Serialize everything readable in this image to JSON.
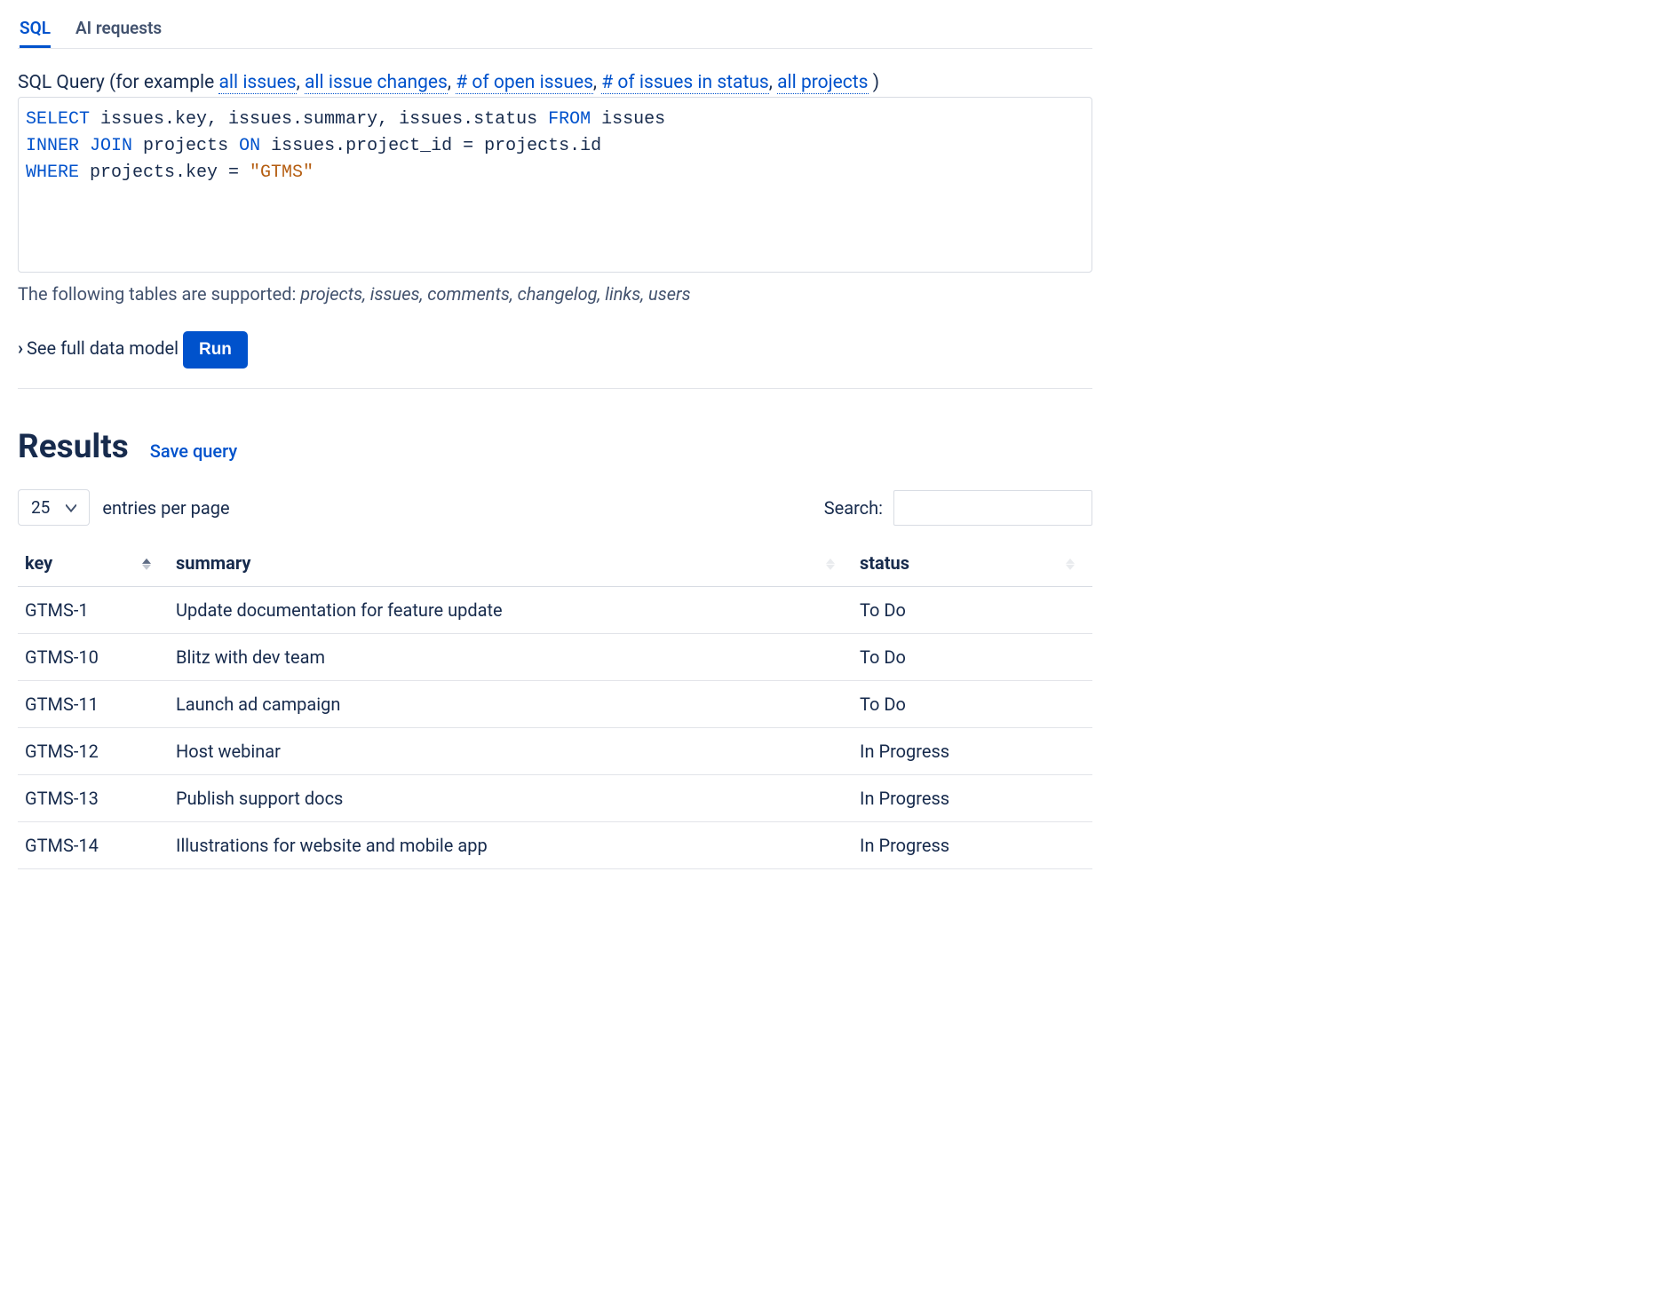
{
  "tabs": {
    "sql": "SQL",
    "ai": "AI requests",
    "active": "sql"
  },
  "queryLabel": {
    "prefix": "SQL Query (for example ",
    "examples": [
      "all issues",
      "all issue changes",
      "# of open issues",
      "# of issues in status",
      "all projects"
    ],
    "suffix": " )"
  },
  "sql": {
    "tokens": [
      {
        "t": "kw",
        "v": "SELECT"
      },
      {
        "t": "",
        "v": " issues.key, issues.summary, issues.status "
      },
      {
        "t": "kw",
        "v": "FROM"
      },
      {
        "t": "",
        "v": " issues\n"
      },
      {
        "t": "kw",
        "v": "INNER"
      },
      {
        "t": "",
        "v": " "
      },
      {
        "t": "kw",
        "v": "JOIN"
      },
      {
        "t": "",
        "v": " projects "
      },
      {
        "t": "kw",
        "v": "ON"
      },
      {
        "t": "",
        "v": " issues.project_id = projects.id\n"
      },
      {
        "t": "kw",
        "v": "WHERE"
      },
      {
        "t": "",
        "v": " projects.key = "
      },
      {
        "t": "str",
        "v": "\"GTMS\""
      }
    ]
  },
  "supportedLine": {
    "prefix": "The following tables are supported: ",
    "tables": [
      "projects",
      "issues",
      "comments",
      "changelog",
      "links",
      "users"
    ]
  },
  "dataModelLink": "See full data model",
  "runButton": "Run",
  "results": {
    "title": "Results",
    "saveQuery": "Save query",
    "entriesSelect": "25",
    "entriesLabel": "entries per page",
    "searchLabel": "Search:",
    "searchValue": "",
    "columns": {
      "key": "key",
      "summary": "summary",
      "status": "status"
    },
    "rows": [
      {
        "key": "GTMS-1",
        "summary": "Update documentation for feature update",
        "status": "To Do"
      },
      {
        "key": "GTMS-10",
        "summary": "Blitz with dev team",
        "status": "To Do"
      },
      {
        "key": "GTMS-11",
        "summary": "Launch ad campaign",
        "status": "To Do"
      },
      {
        "key": "GTMS-12",
        "summary": "Host webinar",
        "status": "In Progress"
      },
      {
        "key": "GTMS-13",
        "summary": "Publish support docs",
        "status": "In Progress"
      },
      {
        "key": "GTMS-14",
        "summary": "Illustrations for website and mobile app",
        "status": "In Progress"
      }
    ]
  }
}
